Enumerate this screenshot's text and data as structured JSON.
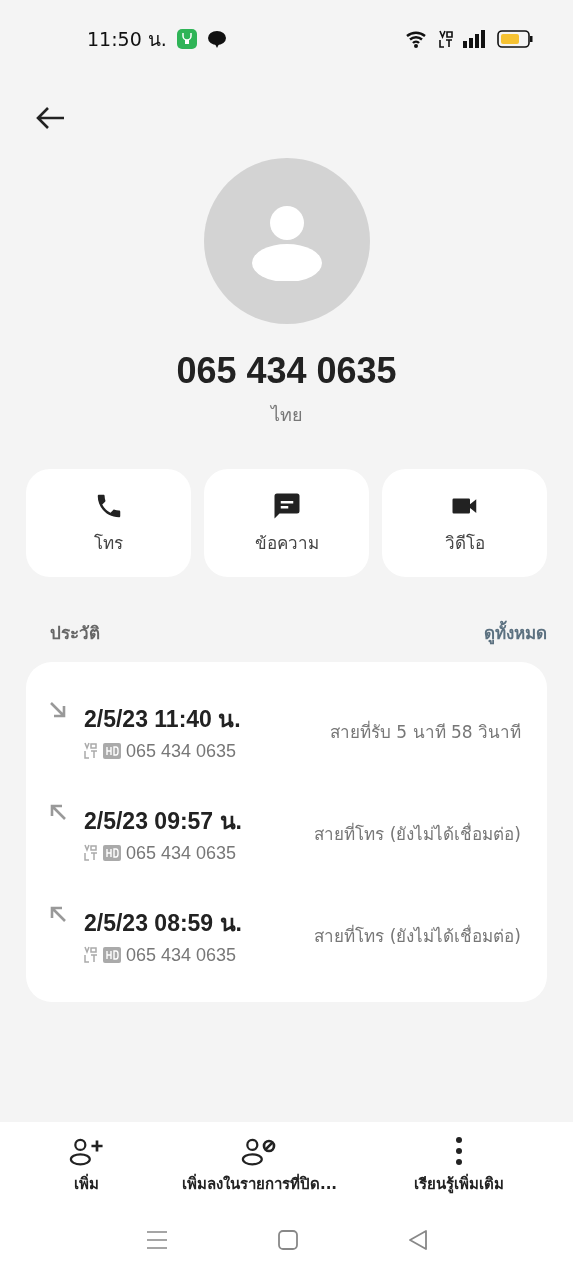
{
  "status_bar": {
    "time": "11:50 น."
  },
  "contact": {
    "number": "065 434 0635",
    "country": "ไทย"
  },
  "actions": [
    {
      "kind": "call",
      "label": "โทร"
    },
    {
      "kind": "message",
      "label": "ข้อความ"
    },
    {
      "kind": "video",
      "label": "วิดีโอ"
    }
  ],
  "history": {
    "title": "ประวัติ",
    "view_all": "ดูทั้งหมด",
    "calls": [
      {
        "kind": "incoming",
        "datetime": "2/5/23 11:40 น.",
        "number": "065 434 0635",
        "status": "สายที่รับ  5 นาที 58 วินาที"
      },
      {
        "kind": "outgoing",
        "datetime": "2/5/23 09:57 น.",
        "number": "065 434 0635",
        "status": "สายที่โทร (ยังไม่ได้เชื่อมต่อ)"
      },
      {
        "kind": "outgoing",
        "datetime": "2/5/23 08:59 น.",
        "number": "065 434 0635",
        "status": "สายที่โทร (ยังไม่ได้เชื่อมต่อ)"
      }
    ]
  },
  "bottom_actions": [
    {
      "kind": "add",
      "label": "เพิ่ม"
    },
    {
      "kind": "block",
      "label": "เพิ่มลงในรายการที่ปิด..."
    },
    {
      "kind": "more",
      "label": "เรียนรู้เพิ่มเติม"
    }
  ]
}
